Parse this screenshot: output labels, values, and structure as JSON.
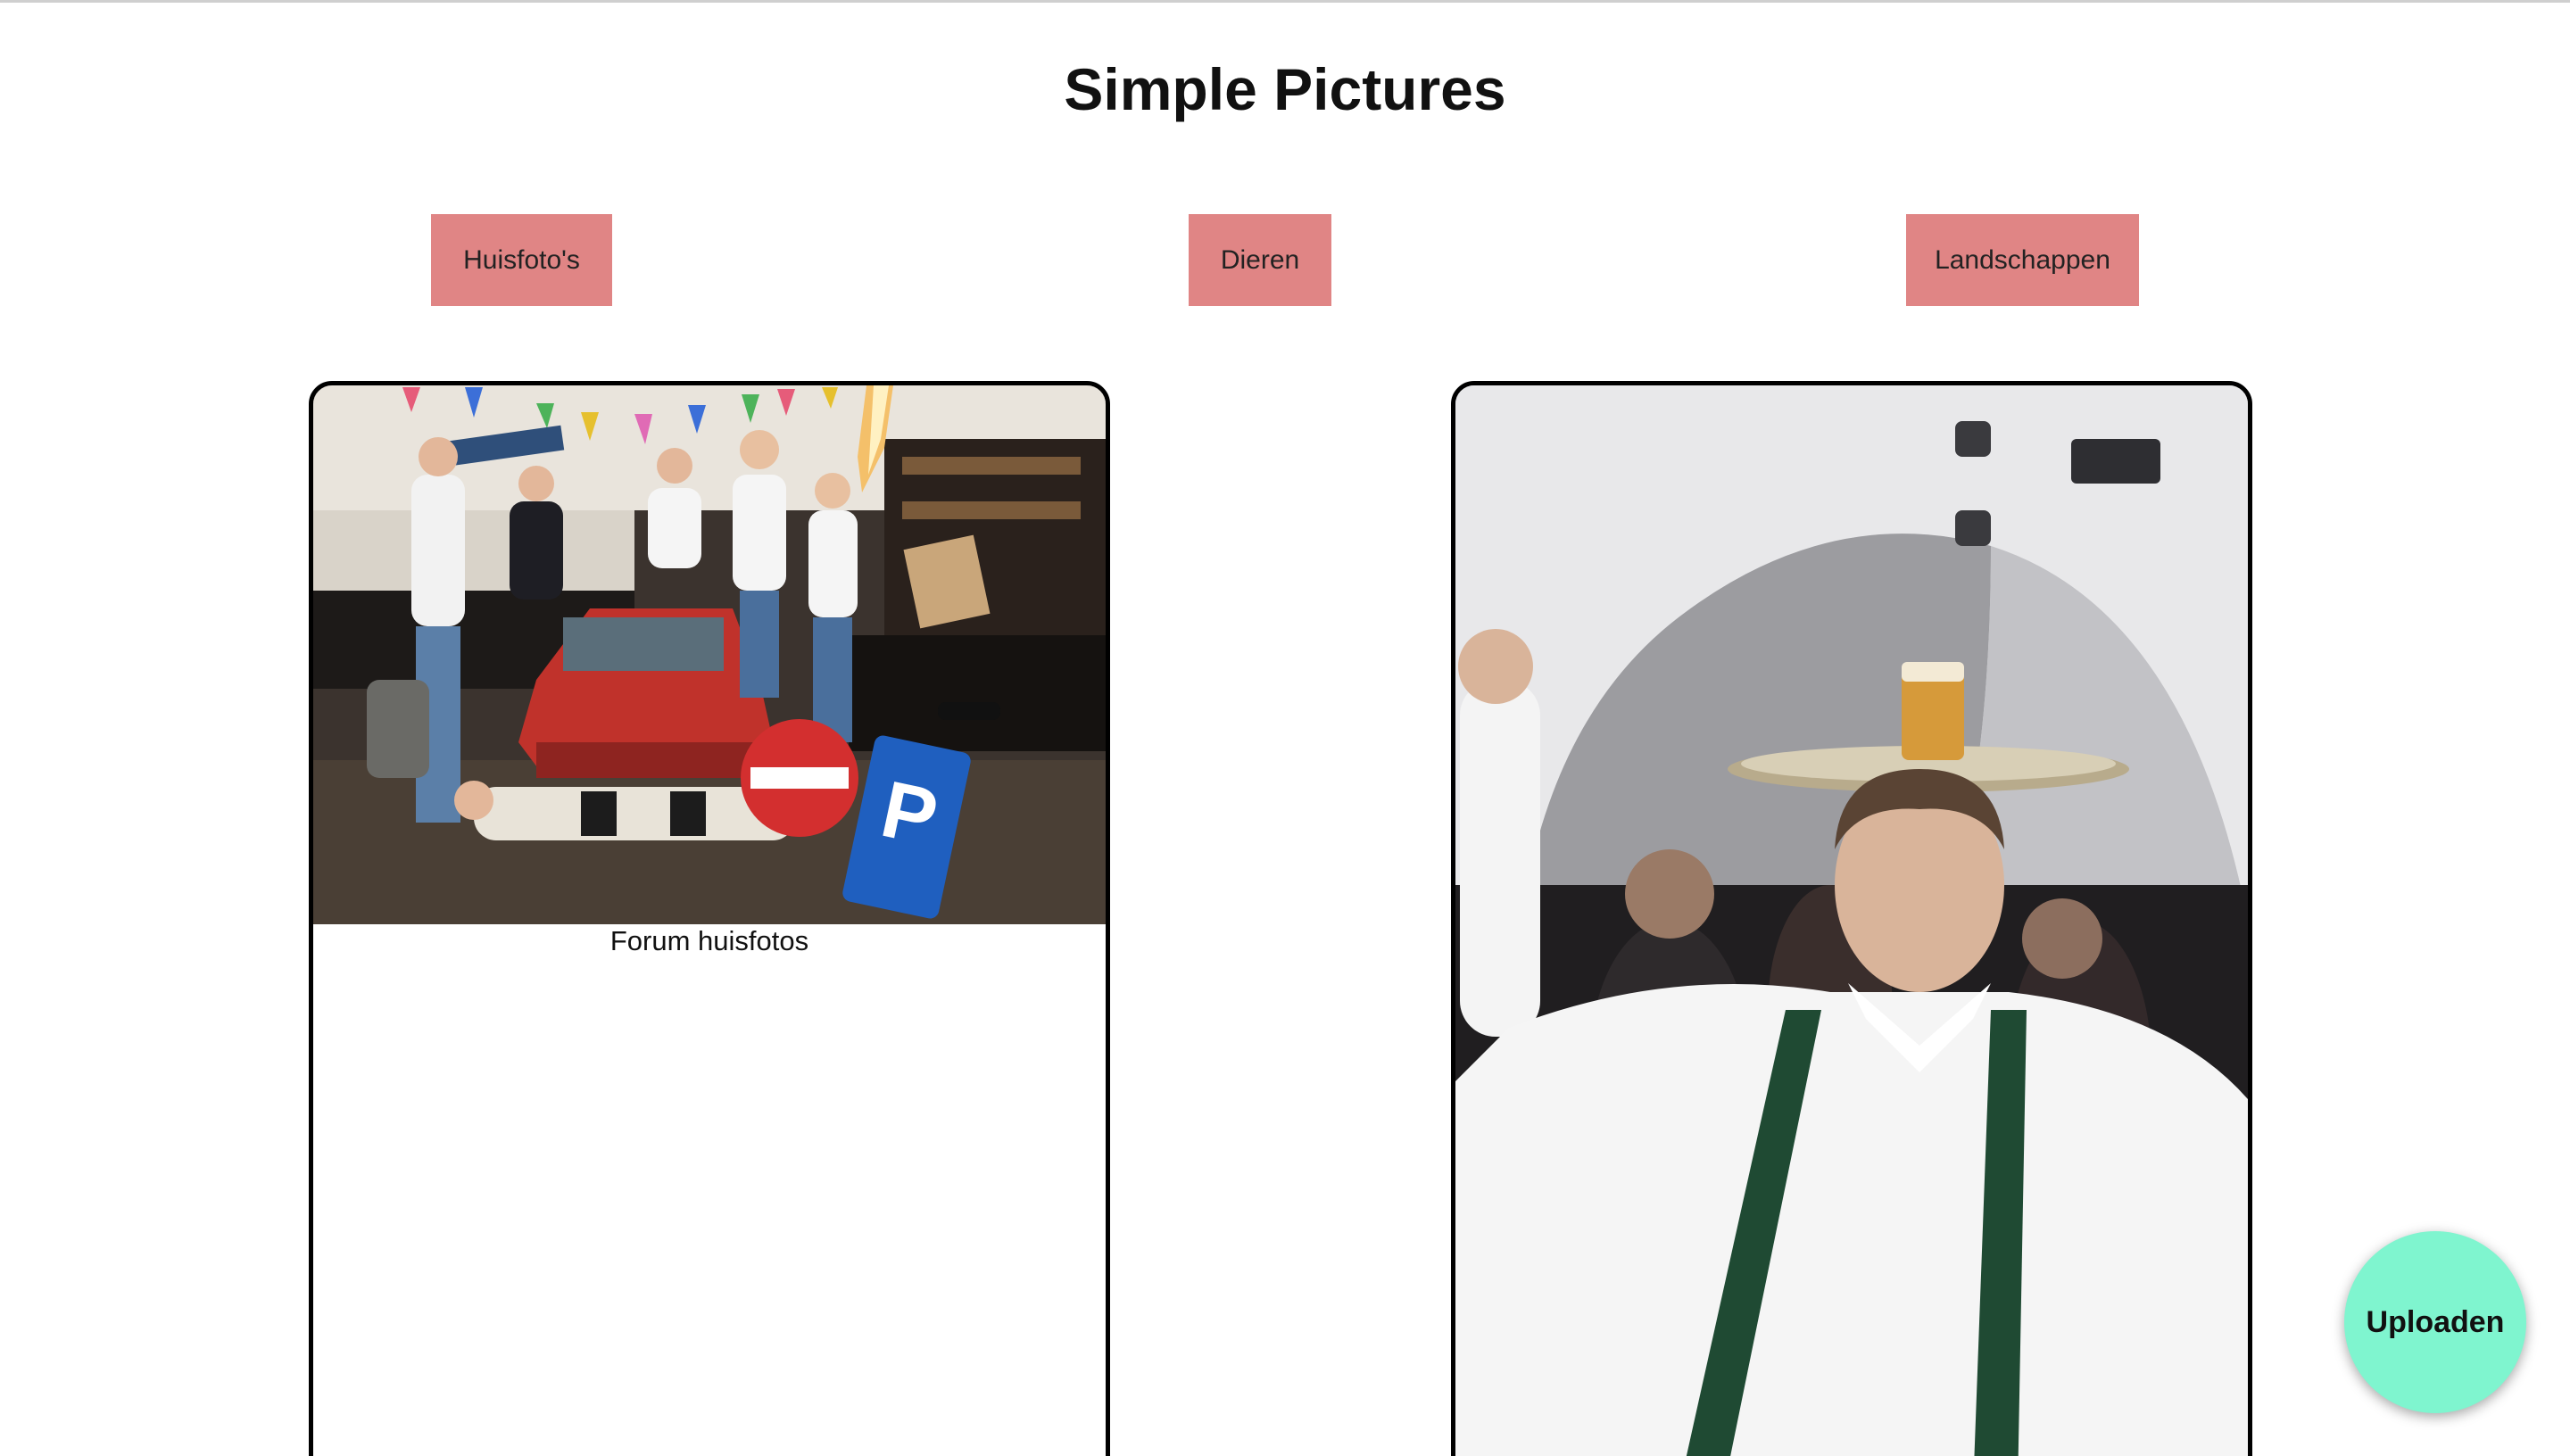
{
  "header": {
    "title": "Simple Pictures"
  },
  "categories": [
    {
      "label": "Huisfoto's"
    },
    {
      "label": "Dieren"
    },
    {
      "label": "Landschappen"
    }
  ],
  "cards": [
    {
      "caption": "Forum huisfotos"
    },
    {
      "caption": ""
    }
  ],
  "upload": {
    "label": "Uploaden"
  },
  "colors": {
    "category_button": "#e08585",
    "upload_button": "#7ff5cf",
    "card_border": "#000000"
  }
}
